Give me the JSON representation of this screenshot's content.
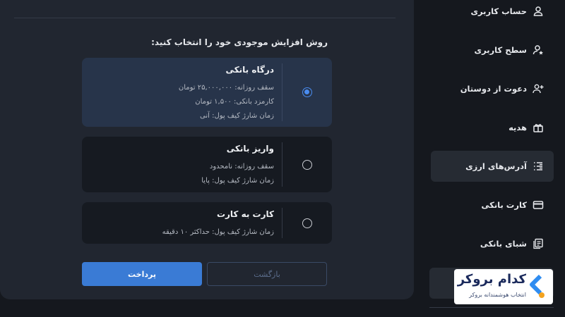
{
  "prompt": "روش افزایش موجودی خود را انتخاب کنید:",
  "options": [
    {
      "title": "درگاه بانکی",
      "lines": [
        "سقف روزانه: ۲۵,۰۰۰,۰۰۰ تومان",
        "کارمزد بانکی: ۱,۵۰۰ تومان",
        "زمان شارژ کیف پول: آنی"
      ],
      "selected": true
    },
    {
      "title": "واریز بانکی",
      "lines": [
        "سقف روزانه: نامحدود",
        "زمان شارژ کیف پول: پایا"
      ],
      "selected": false
    },
    {
      "title": "کارت به کارت",
      "lines": [
        "زمان شارژ کیف پول: حداکثر ۱۰ دقیقه"
      ],
      "selected": false
    }
  ],
  "buttons": {
    "pay": "پرداخت",
    "back": "بازگشت"
  },
  "sidebar": {
    "items": [
      {
        "label": "حساب کاربری",
        "icon": "user-icon"
      },
      {
        "label": "سطح کاربری",
        "icon": "user-star-icon"
      },
      {
        "label": "دعوت از دوستان",
        "icon": "user-add-icon"
      },
      {
        "label": "هدیه",
        "icon": "gift-icon"
      },
      {
        "label": "آدرس‌های ارزی",
        "icon": "list-icon"
      },
      {
        "label": "کارت بانکی",
        "icon": "card-icon"
      },
      {
        "label": "شبای بانکی",
        "icon": "document-icon"
      }
    ],
    "active_index": 4
  },
  "logo": {
    "brand": "کدام بروکر",
    "tagline": "انتخاب هوشمندانه بروکر"
  },
  "colors": {
    "accent": "#3a7bd5",
    "panel": "#212630",
    "background": "#15181e"
  }
}
